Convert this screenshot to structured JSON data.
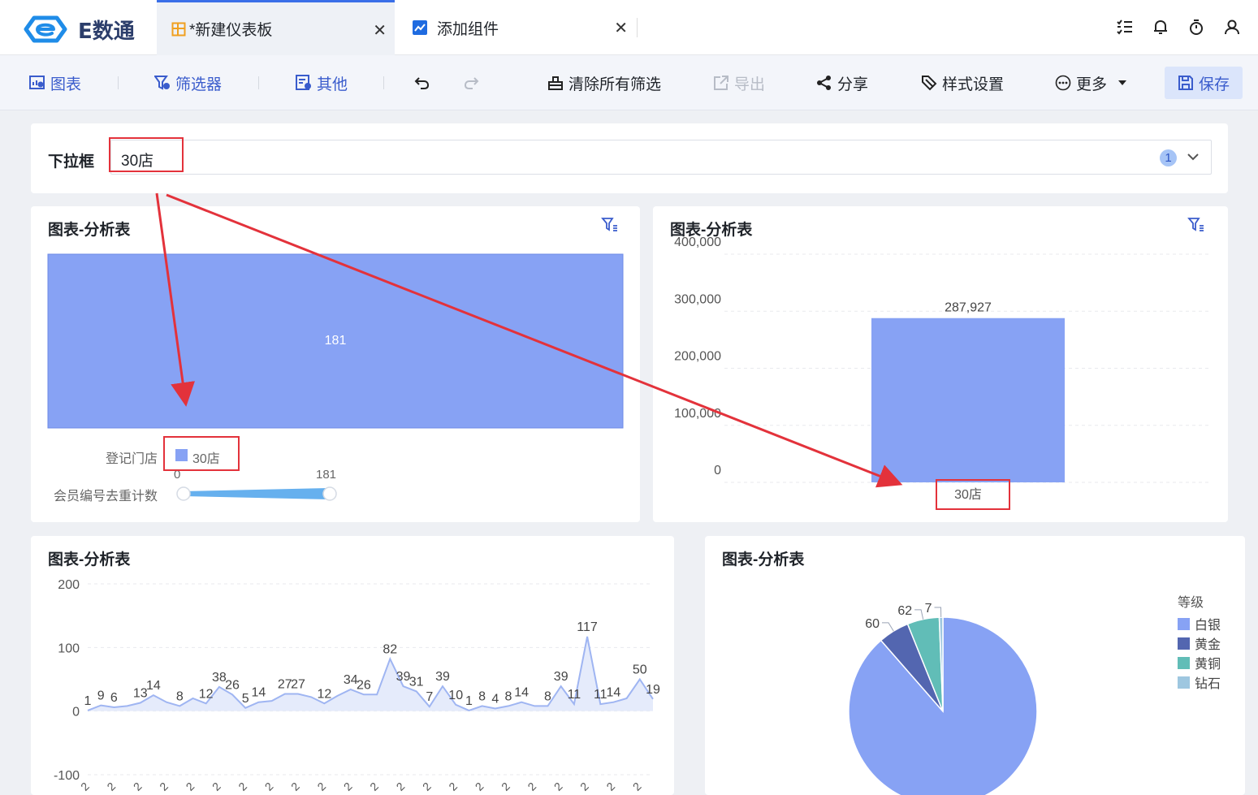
{
  "app": {
    "logo_text": "E数通"
  },
  "tabs": [
    {
      "label": "*新建仪表板",
      "icon": "dashboard-icon",
      "active": true
    },
    {
      "label": "添加组件",
      "icon": "chart-line-icon",
      "active": false
    }
  ],
  "top_icons": [
    "task-list-icon",
    "bell-icon",
    "timer-icon",
    "user-icon"
  ],
  "toolbar": {
    "chart": "图表",
    "filter": "筛选器",
    "other": "其他",
    "undo_icon": "undo-icon",
    "redo_icon": "redo-icon",
    "clear_filters": "清除所有筛选",
    "export": "导出",
    "share": "分享",
    "style_settings": "样式设置",
    "more": "更多",
    "save": "保存"
  },
  "dropdown_filter": {
    "label": "下拉框",
    "value": "30店",
    "badge": "1"
  },
  "widgets": [
    {
      "title": "图表-分析表",
      "chart_data": {
        "type": "heatmap",
        "cells": [
          {
            "row": "30店",
            "value": 181,
            "label": "181"
          }
        ],
        "legend": {
          "dimension_label": "登记门店",
          "dimension_value": "30店",
          "measure_label": "会员编号去重计数",
          "range_min": "0",
          "range_max": "181"
        }
      }
    },
    {
      "title": "图表-分析表",
      "chart_data": {
        "type": "bar",
        "categories": [
          "30店"
        ],
        "values": [
          287927
        ],
        "value_labels": [
          "287,927"
        ],
        "ylim": [
          0,
          400000
        ],
        "yticks": [
          "400,000",
          "300,000",
          "200,000",
          "100,000",
          "0"
        ],
        "grid": true
      }
    },
    {
      "title": "图表-分析表",
      "chart_data": {
        "type": "area",
        "values": [
          1,
          9,
          6,
          8,
          13,
          25,
          14,
          8,
          20,
          12,
          38,
          26,
          5,
          14,
          16,
          27,
          27,
          22,
          12,
          24,
          34,
          26,
          26,
          82,
          39,
          31,
          7,
          39,
          10,
          1,
          8,
          4,
          8,
          14,
          8,
          8,
          39,
          11,
          117,
          11,
          14,
          20,
          50,
          19
        ],
        "point_labels": [
          {
            "i": 0,
            "text": "1"
          },
          {
            "i": 1,
            "text": "9"
          },
          {
            "i": 2,
            "text": "6"
          },
          {
            "i": 4,
            "text": "13"
          },
          {
            "i": 5,
            "text": "14"
          },
          {
            "i": 7,
            "text": "8"
          },
          {
            "i": 9,
            "text": "12"
          },
          {
            "i": 10,
            "text": "38"
          },
          {
            "i": 11,
            "text": "26"
          },
          {
            "i": 12,
            "text": "5"
          },
          {
            "i": 13,
            "text": "14"
          },
          {
            "i": 15,
            "text": "27"
          },
          {
            "i": 16,
            "text": "27"
          },
          {
            "i": 18,
            "text": "12"
          },
          {
            "i": 20,
            "text": "34"
          },
          {
            "i": 21,
            "text": "26"
          },
          {
            "i": 23,
            "text": "82"
          },
          {
            "i": 24,
            "text": "39"
          },
          {
            "i": 25,
            "text": "31"
          },
          {
            "i": 26,
            "text": "7"
          },
          {
            "i": 27,
            "text": "39"
          },
          {
            "i": 28,
            "text": "10"
          },
          {
            "i": 29,
            "text": "1"
          },
          {
            "i": 30,
            "text": "8"
          },
          {
            "i": 31,
            "text": "4"
          },
          {
            "i": 32,
            "text": "8"
          },
          {
            "i": 33,
            "text": "14"
          },
          {
            "i": 35,
            "text": "8"
          },
          {
            "i": 36,
            "text": "39"
          },
          {
            "i": 37,
            "text": "11"
          },
          {
            "i": 38,
            "text": "117"
          },
          {
            "i": 39,
            "text": "11"
          },
          {
            "i": 40,
            "text": "14"
          },
          {
            "i": 42,
            "text": "50"
          },
          {
            "i": 43,
            "text": "19"
          }
        ],
        "ylim": [
          -100,
          200
        ],
        "yticks": [
          "200",
          "100",
          "0",
          "-100"
        ],
        "x_tick_text": "2",
        "grid": true
      }
    },
    {
      "title": "图表-分析表",
      "chart_data": {
        "type": "pie",
        "legend_title": "等级",
        "slices": [
          {
            "name": "白银",
            "value": 1000,
            "label": "",
            "color": "#87a2f4"
          },
          {
            "name": "黄金",
            "value": 60,
            "label": "60",
            "color": "#5366b0"
          },
          {
            "name": "黄铜",
            "value": 62,
            "label": "62",
            "color": "#61bdb7"
          },
          {
            "name": "钻石",
            "value": 7,
            "label": "7",
            "color": "#9ec7e0"
          }
        ]
      }
    }
  ],
  "colors": {
    "accent": "#3a5ccc",
    "bar": "#87a2f4",
    "annotation": "#e3323b"
  }
}
